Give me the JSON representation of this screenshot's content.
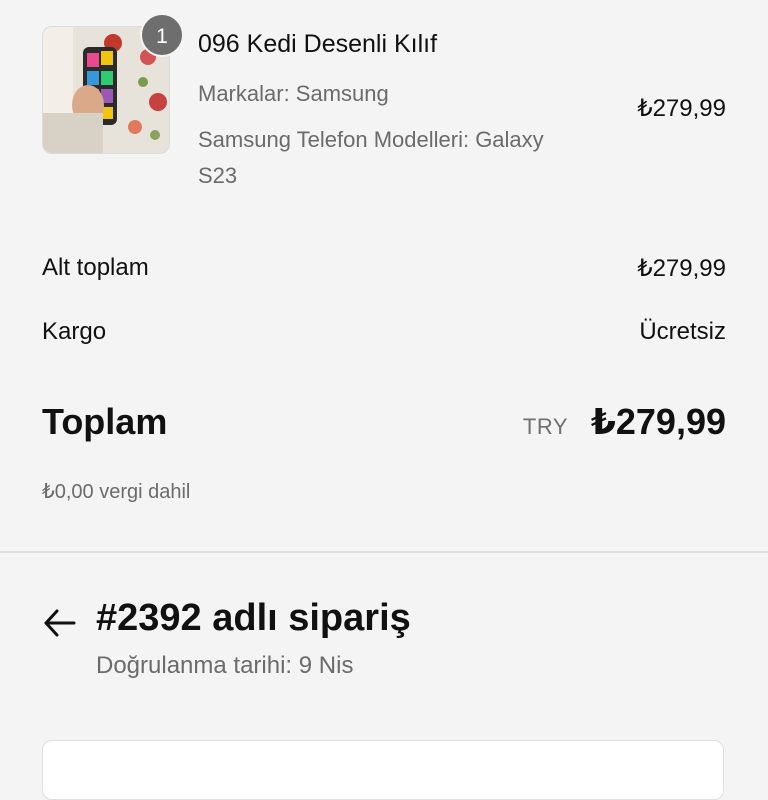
{
  "item": {
    "quantity": "1",
    "name": "096 Kedi Desenli Kılıf",
    "brand": "Markalar: Samsung",
    "model_line1": "Samsung Telefon Modelleri: Galaxy",
    "model_line2": "S23",
    "price": "₺279,99",
    "image_icon": "product-photo"
  },
  "summary": {
    "subtotal_label": "Alt toplam",
    "subtotal_value": "₺279,99",
    "shipping_label": "Kargo",
    "shipping_value": "Ücretsiz",
    "total_label": "Toplam",
    "total_currency": "TRY",
    "total_value": "₺279,99",
    "tax_note": "₺0,00 vergi dahil"
  },
  "order": {
    "back_icon": "arrow-left-icon",
    "title": "#2392 adlı sipariş",
    "subtitle": "Doğrulanma tarihi: 9 Nis"
  },
  "colors": {
    "background": "#f4f4f4",
    "badge": "#6e6e6e",
    "muted_text": "#6b6b6b"
  }
}
